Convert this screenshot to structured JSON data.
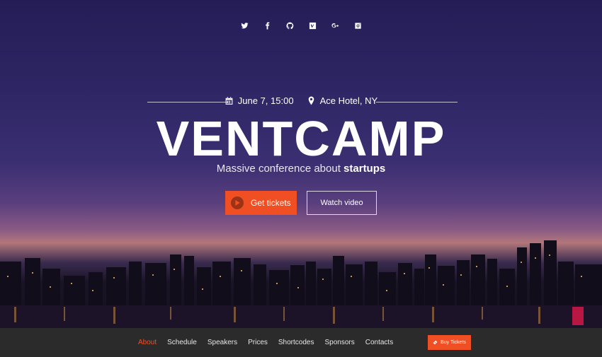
{
  "socials": [
    {
      "name": "twitter-icon",
      "glyph": "t"
    },
    {
      "name": "facebook-icon",
      "glyph": "f"
    },
    {
      "name": "github-icon",
      "glyph": "gh"
    },
    {
      "name": "vimeo-icon",
      "glyph": "V"
    },
    {
      "name": "google-plus-icon",
      "glyph": "g+"
    },
    {
      "name": "instagram-icon",
      "glyph": "ig"
    }
  ],
  "event": {
    "date": "June 7, 15:00",
    "location": "Ace Hotel, NY",
    "title": "VENTCAMP",
    "tagline_prefix": "Massive conference about ",
    "tagline_bold": "startups"
  },
  "buttons": {
    "get_tickets": "Get tickets",
    "watch_video": "Watch video"
  },
  "nav": {
    "items": [
      "About",
      "Schedule",
      "Speakers",
      "Prices",
      "Shortcodes",
      "Sponsors",
      "Contacts"
    ],
    "buy_tickets": "Buy Tickets"
  },
  "colors": {
    "accent": "#f04e23",
    "nav_bg": "#2b2b2b"
  }
}
